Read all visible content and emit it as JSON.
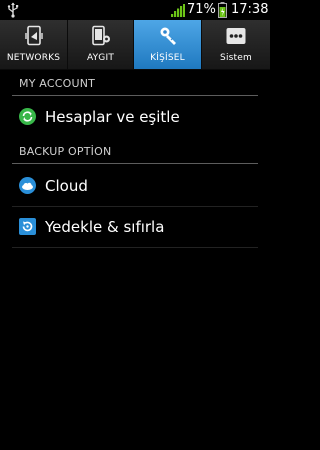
{
  "status_bar": {
    "battery_percent": "71%",
    "time": "17:38",
    "icons": [
      "usb-icon",
      "signal-icon",
      "battery-icon"
    ],
    "accent": "#6cc417"
  },
  "tabs": [
    {
      "label": "NETWORKS",
      "icon": "networks-icon",
      "selected": false
    },
    {
      "label": "AYGIT",
      "icon": "device-icon",
      "selected": false
    },
    {
      "label": "KİŞİSEL",
      "icon": "personal-icon",
      "selected": true
    },
    {
      "label": "Sistem",
      "icon": "more-icon",
      "selected": false
    }
  ],
  "sections": {
    "my_account": {
      "header": "MY ACCOUNT",
      "items": [
        {
          "label": "Hesaplar ve eşitle",
          "icon": "sync-icon"
        }
      ]
    },
    "backup": {
      "header": "BACKUP OPTİON",
      "items": [
        {
          "label": "Cloud",
          "icon": "cloud-icon"
        },
        {
          "label": "Yedekle & sıfırla",
          "icon": "backup-reset-icon"
        }
      ]
    }
  },
  "colors": {
    "selected_tab": "#3a93d9",
    "background": "#000000"
  }
}
